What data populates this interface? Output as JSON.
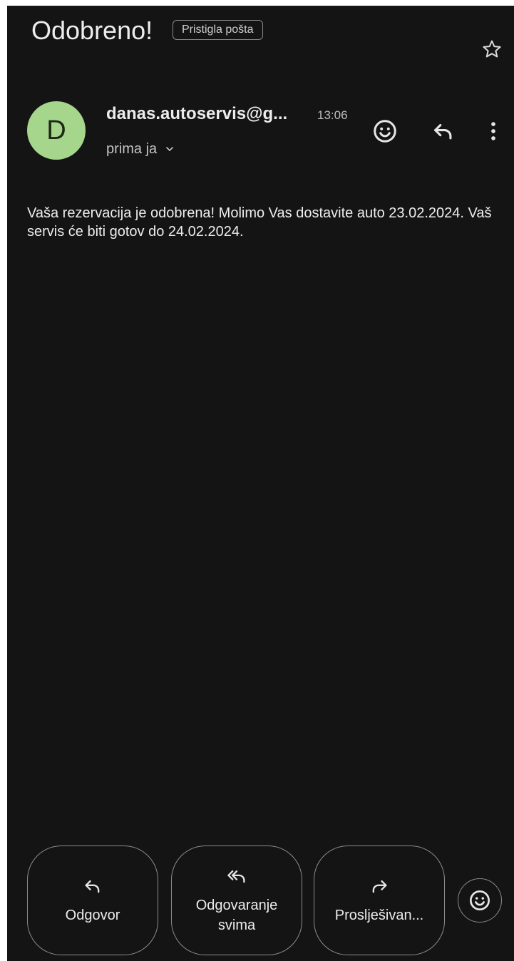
{
  "email": {
    "subject": "Odobreno!",
    "label": "Pristigla pošta",
    "sender": {
      "avatar_letter": "D",
      "name": "danas.autoservis@g...",
      "time": "13:06",
      "recipient": "prima ja"
    },
    "body": "Vaša rezervacija je odobrena! Molimo Vas dostavite auto 23.02.2024. Vaš servis će biti gotov do 24.02.2024."
  },
  "actions": {
    "reply": "Odgovor",
    "reply_all": "Odgovaranje\nsvima",
    "forward": "Proslješivan..."
  },
  "icons": {
    "star": "star-icon",
    "emoji": "smiley-icon",
    "reply": "reply-icon",
    "more": "more-vert-icon",
    "chevron": "chevron-down-icon",
    "reply_all": "reply-all-icon",
    "forward": "forward-icon"
  },
  "colors": {
    "background": "#141414",
    "avatar": "#a5d68b",
    "text": "#ececec",
    "outline": "#8c8c8c"
  }
}
